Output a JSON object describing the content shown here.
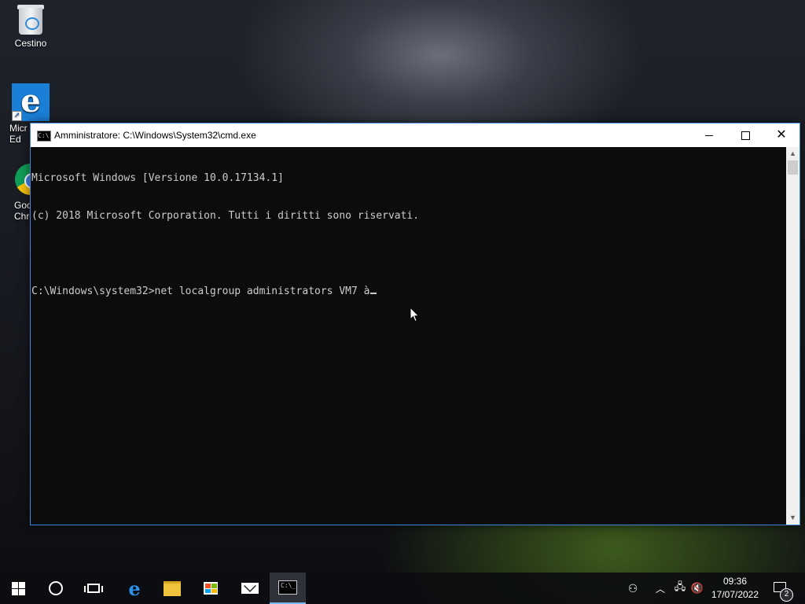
{
  "desktop": {
    "icons": [
      {
        "label": "Cestino",
        "icon": "recycle-bin-icon"
      },
      {
        "label": "Micr Ed",
        "icon": "edge-icon"
      },
      {
        "label": "Goo Chro",
        "icon": "chrome-icon"
      }
    ]
  },
  "window": {
    "title": "Amministratore: C:\\Windows\\System32\\cmd.exe",
    "console_lines": [
      "Microsoft Windows [Versione 10.0.17134.1]",
      "(c) 2018 Microsoft Corporation. Tutti i diritti sono riservati.",
      "",
      "C:\\Windows\\system32>net localgroup administrators VM7 à"
    ],
    "minimize_icon": "minimize-icon",
    "maximize_icon": "maximize-icon",
    "close_icon": "close-icon",
    "accent_color": "#3c8ad6"
  },
  "taskbar": {
    "apps": [
      "start-icon",
      "cortana-icon",
      "task-view-icon",
      "edge-icon",
      "file-explorer-icon",
      "store-icon",
      "mail-icon",
      "cmd-icon"
    ],
    "active_app": "cmd-icon",
    "clock": {
      "time": "09:36",
      "date": "17/07/2022"
    },
    "notifications_count": "2"
  }
}
